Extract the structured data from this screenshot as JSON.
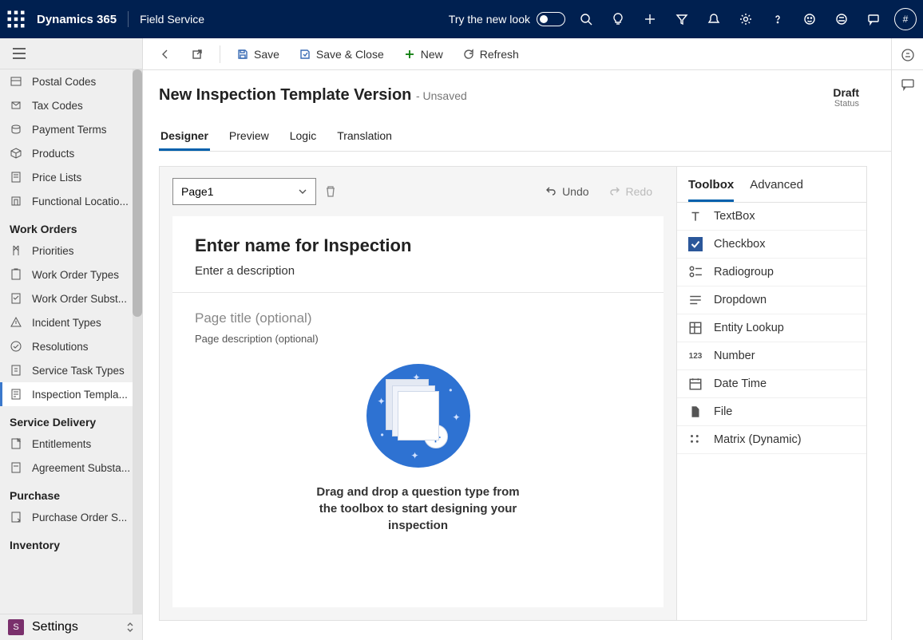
{
  "topbar": {
    "brand": "Dynamics 365",
    "app": "Field Service",
    "tryNewLook": "Try the new look",
    "avatar": "#"
  },
  "sidebar": {
    "items1": [
      {
        "label": "Postal Codes"
      },
      {
        "label": "Tax Codes"
      },
      {
        "label": "Payment Terms"
      },
      {
        "label": "Products"
      },
      {
        "label": "Price Lists"
      },
      {
        "label": "Functional Locatio..."
      }
    ],
    "section_wo": "Work Orders",
    "items_wo": [
      {
        "label": "Priorities"
      },
      {
        "label": "Work Order Types"
      },
      {
        "label": "Work Order Subst..."
      },
      {
        "label": "Incident Types"
      },
      {
        "label": "Resolutions"
      },
      {
        "label": "Service Task Types"
      },
      {
        "label": "Inspection Templa...",
        "active": true
      }
    ],
    "section_sd": "Service Delivery",
    "items_sd": [
      {
        "label": "Entitlements"
      },
      {
        "label": "Agreement Substa..."
      }
    ],
    "section_pu": "Purchase",
    "items_pu": [
      {
        "label": "Purchase Order S..."
      }
    ],
    "section_inv": "Inventory",
    "footer_badge": "S",
    "footer_label": "Settings"
  },
  "cmdbar": {
    "save": "Save",
    "saveClose": "Save & Close",
    "new": "New",
    "refresh": "Refresh"
  },
  "record": {
    "title": "New Inspection Template Version",
    "unsaved": "- Unsaved",
    "statusVal": "Draft",
    "statusLbl": "Status"
  },
  "tabs": [
    "Designer",
    "Preview",
    "Logic",
    "Translation"
  ],
  "designer": {
    "pageSelect": "Page1",
    "undo": "Undo",
    "redo": "Redo",
    "inspName": "Enter name for Inspection",
    "inspDesc": "Enter a description",
    "pageTitle": "Page title (optional)",
    "pageDesc": "Page description (optional)",
    "emptyL1": "Drag and drop a question type from",
    "emptyL2": "the toolbox to start designing your",
    "emptyL3": "inspection"
  },
  "toolbox": {
    "tab1": "Toolbox",
    "tab2": "Advanced",
    "items": [
      {
        "label": "TextBox"
      },
      {
        "label": "Checkbox"
      },
      {
        "label": "Radiogroup"
      },
      {
        "label": "Dropdown"
      },
      {
        "label": "Entity Lookup"
      },
      {
        "label": "Number"
      },
      {
        "label": "Date Time"
      },
      {
        "label": "File"
      },
      {
        "label": "Matrix (Dynamic)"
      }
    ]
  }
}
